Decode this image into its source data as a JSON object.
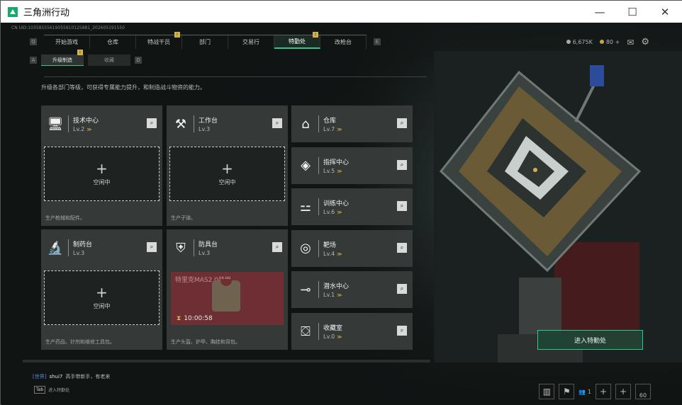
{
  "window": {
    "title": "三角洲行动",
    "minimize": "—",
    "maximize": "☐",
    "close": "✕"
  },
  "uid": "CN UID:10358555619055810125881_202605191550",
  "nav": {
    "left_key": "Q",
    "right_key": "E",
    "tabs": [
      {
        "label": "开始游戏",
        "badge": ""
      },
      {
        "label": "仓库",
        "badge": ""
      },
      {
        "label": "特战干员",
        "badge": "!"
      },
      {
        "label": "部门",
        "badge": ""
      },
      {
        "label": "交易行",
        "badge": ""
      },
      {
        "label": "特勤处",
        "badge": "!"
      },
      {
        "label": "改枪台",
        "badge": ""
      }
    ]
  },
  "currency": {
    "silver": "6,675K",
    "gold": "80",
    "add": "+"
  },
  "subnav": {
    "left_key": "A",
    "right_key": "D",
    "tabs": [
      {
        "label": "升级制造",
        "badge": "!"
      },
      {
        "label": "收藏",
        "badge": ""
      }
    ]
  },
  "description": "升级各部门等级，可获得专属能力提升，和制造战斗物资的能力。",
  "search_glyph": "⌕",
  "chevron": "≫",
  "facilities_large": [
    {
      "name": "技术中心",
      "level": "Lv.2",
      "upgrade": true,
      "icon": "monitor-icon",
      "status": "空闲中",
      "footer": "生产枪械和配件。"
    },
    {
      "name": "工作台",
      "level": "Lv.3",
      "upgrade": false,
      "icon": "tools-icon",
      "status": "空闲中",
      "footer": "生产子弹。"
    },
    {
      "name": "制药台",
      "level": "Lv.3",
      "upgrade": false,
      "icon": "microscope-icon",
      "status": "空闲中",
      "footer": "生产药品、针剂和维修工具包。"
    },
    {
      "name": "防具台",
      "level": "Lv.3",
      "upgrade": false,
      "icon": "armor-icon",
      "status": "",
      "footer": "生产头盔、护甲、胸挂和背包。",
      "production": {
        "item": "特里克MAS2.0装甲",
        "timer": "10:00:58"
      }
    }
  ],
  "facilities_small": [
    {
      "name": "仓库",
      "level": "Lv.7",
      "upgrade": true,
      "icon": "warehouse-icon"
    },
    {
      "name": "指挥中心",
      "level": "Lv.5",
      "upgrade": true,
      "icon": "command-icon"
    },
    {
      "name": "训练中心",
      "level": "Lv.6",
      "upgrade": true,
      "icon": "dumbbell-icon"
    },
    {
      "name": "靶场",
      "level": "Lv.4",
      "upgrade": true,
      "icon": "target-icon"
    },
    {
      "name": "潜水中心",
      "level": "Lv.1",
      "upgrade": true,
      "icon": "diving-icon"
    },
    {
      "name": "收藏室",
      "level": "Lv.0",
      "upgrade": true,
      "icon": "collection-icon"
    }
  ],
  "enter_button": "进入特勤处",
  "chat": {
    "channel": "[世界]",
    "user": "shui7",
    "message": "高手带新手，有老来"
  },
  "tab_hint": {
    "key": "Tab",
    "label": "进入特勤处"
  },
  "bottom_right": {
    "count": "1",
    "value": "60"
  }
}
